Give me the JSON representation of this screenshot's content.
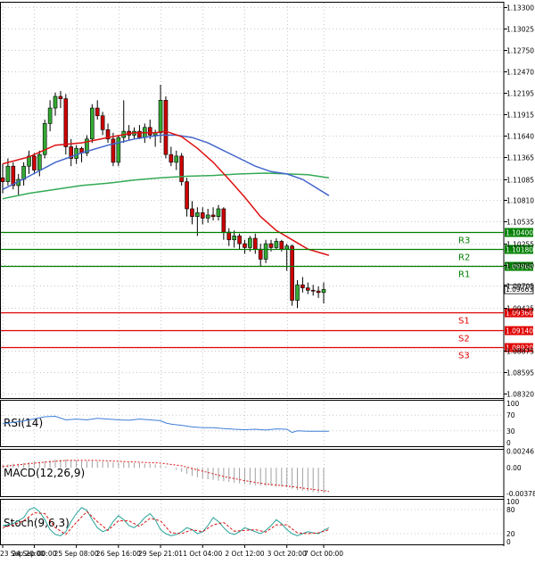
{
  "chart_data": {
    "type": "candlestick",
    "price_axis": {
      "ticks": [
        "1.13300",
        "1.13025",
        "1.12750",
        "1.12470",
        "1.12195",
        "1.11915",
        "1.11640",
        "1.11365",
        "1.11085",
        "1.10810",
        "1.10535",
        "1.10255",
        "1.09980",
        "1.09705",
        "1.09425",
        "1.08875",
        "1.08595",
        "1.08320"
      ],
      "tick_values": [
        1.133,
        1.13025,
        1.1275,
        1.1247,
        1.12195,
        1.11915,
        1.1164,
        1.11365,
        1.11085,
        1.1081,
        1.10535,
        1.10255,
        1.0998,
        1.09705,
        1.09425,
        1.08875,
        1.08595,
        1.0832
      ],
      "range": [
        1.0826,
        1.1337
      ]
    },
    "time_axis": {
      "labels": [
        "23 Sep 20:00",
        "24 Sep 00:00",
        "25 Sep 08:00",
        "26 Sep 16:00",
        "29 Sep 21:01",
        "1 Oct 04:00",
        "2 Oct 12:00",
        "3 Oct 20:00",
        "7 Oct 00:00"
      ],
      "label_bars": [
        0,
        6,
        14,
        22,
        30,
        38,
        46,
        54,
        61
      ]
    },
    "current_price": "1.09663",
    "levels": [
      {
        "name": "R3",
        "price": 1.104,
        "label": "1.10400",
        "color": "#008000"
      },
      {
        "name": "R2",
        "price": 1.1018,
        "label": "1.10180",
        "color": "#008000"
      },
      {
        "name": "R1",
        "price": 1.0996,
        "label": "1.09960",
        "color": "#008000"
      },
      {
        "name": "S1",
        "price": 1.0936,
        "label": "1.09360",
        "color": "#e00000"
      },
      {
        "name": "S2",
        "price": 1.0914,
        "label": "1.09140",
        "color": "#e00000"
      },
      {
        "name": "S3",
        "price": 1.0892,
        "label": "1.08920",
        "color": "#e00000"
      }
    ],
    "candles": [
      [
        1.111,
        1.1128,
        1.109,
        1.1105
      ],
      [
        1.1105,
        1.1135,
        1.11,
        1.1125
      ],
      [
        1.1125,
        1.113,
        1.1095,
        1.11
      ],
      [
        1.11,
        1.1115,
        1.1088,
        1.1108
      ],
      [
        1.1108,
        1.113,
        1.11,
        1.1125
      ],
      [
        1.1125,
        1.1145,
        1.1115,
        1.1138
      ],
      [
        1.1138,
        1.1142,
        1.1115,
        1.112
      ],
      [
        1.112,
        1.1145,
        1.1112,
        1.114
      ],
      [
        1.114,
        1.1185,
        1.1135,
        1.118
      ],
      [
        1.118,
        1.121,
        1.117,
        1.12
      ],
      [
        1.12,
        1.122,
        1.119,
        1.1215
      ],
      [
        1.1215,
        1.1222,
        1.12,
        1.1212
      ],
      [
        1.1212,
        1.1218,
        1.114,
        1.115
      ],
      [
        1.115,
        1.116,
        1.1125,
        1.1135
      ],
      [
        1.1135,
        1.1152,
        1.1128,
        1.1148
      ],
      [
        1.1148,
        1.115,
        1.113,
        1.1142
      ],
      [
        1.1142,
        1.1165,
        1.1138,
        1.116
      ],
      [
        1.116,
        1.1205,
        1.1155,
        1.12
      ],
      [
        1.12,
        1.121,
        1.1185,
        1.119
      ],
      [
        1.119,
        1.1195,
        1.1165,
        1.1172
      ],
      [
        1.1172,
        1.118,
        1.1155,
        1.116
      ],
      [
        1.116,
        1.1168,
        1.1125,
        1.113
      ],
      [
        1.113,
        1.1165,
        1.1125,
        1.1162
      ],
      [
        1.1162,
        1.121,
        1.1155,
        1.117
      ],
      [
        1.117,
        1.1178,
        1.1158,
        1.1165
      ],
      [
        1.1165,
        1.1175,
        1.116,
        1.117
      ],
      [
        1.117,
        1.1178,
        1.116,
        1.1162
      ],
      [
        1.1162,
        1.118,
        1.1155,
        1.1175
      ],
      [
        1.1175,
        1.1185,
        1.116,
        1.1165
      ],
      [
        1.1165,
        1.1172,
        1.115,
        1.1168
      ],
      [
        1.1168,
        1.123,
        1.1155,
        1.121
      ],
      [
        1.121,
        1.1215,
        1.1135,
        1.114
      ],
      [
        1.114,
        1.115,
        1.1125,
        1.113
      ],
      [
        1.113,
        1.1145,
        1.112,
        1.1138
      ],
      [
        1.1138,
        1.1142,
        1.11,
        1.1105
      ],
      [
        1.1105,
        1.111,
        1.106,
        1.107
      ],
      [
        1.107,
        1.108,
        1.105,
        1.106
      ],
      [
        1.106,
        1.1072,
        1.1035,
        1.1065
      ],
      [
        1.1065,
        1.1072,
        1.105,
        1.1058
      ],
      [
        1.1058,
        1.107,
        1.1052,
        1.1062
      ],
      [
        1.1062,
        1.1072,
        1.1055,
        1.106
      ],
      [
        1.106,
        1.1075,
        1.1055,
        1.107
      ],
      [
        1.107,
        1.1072,
        1.103,
        1.104
      ],
      [
        1.104,
        1.1045,
        1.1022,
        1.103
      ],
      [
        1.103,
        1.1042,
        1.102,
        1.1035
      ],
      [
        1.1035,
        1.1038,
        1.1018,
        1.1025
      ],
      [
        1.1025,
        1.103,
        1.1012,
        1.102
      ],
      [
        1.102,
        1.1035,
        1.1015,
        1.1032
      ],
      [
        1.1032,
        1.1038,
        1.1012,
        1.1018
      ],
      [
        1.1018,
        1.1025,
        1.0995,
        1.1005
      ],
      [
        1.1005,
        1.103,
        1.1,
        1.1025
      ],
      [
        1.1025,
        1.103,
        1.1015,
        1.102
      ],
      [
        1.102,
        1.1032,
        1.1018,
        1.1028
      ],
      [
        1.1028,
        1.103,
        1.1015,
        1.1018
      ],
      [
        1.1018,
        1.1025,
        1.099,
        1.1022
      ],
      [
        1.1022,
        1.1024,
        1.0945,
        1.0952
      ],
      [
        1.0952,
        1.0978,
        1.0942,
        1.0972
      ],
      [
        1.0972,
        1.0982,
        1.0962,
        1.0968
      ],
      [
        1.0968,
        1.0975,
        1.096,
        1.0965
      ],
      [
        1.0965,
        1.0972,
        1.0958,
        1.0964
      ],
      [
        1.0964,
        1.097,
        1.0955,
        1.0962
      ],
      [
        1.0962,
        1.0975,
        1.0948,
        1.0966
      ]
    ],
    "ma_fast": [
      [
        0,
        1.1128
      ],
      [
        5,
        1.1137
      ],
      [
        10,
        1.1152
      ],
      [
        15,
        1.1155
      ],
      [
        20,
        1.1162
      ],
      [
        25,
        1.1168
      ],
      [
        29,
        1.1168
      ],
      [
        31,
        1.117
      ],
      [
        34,
        1.1163
      ],
      [
        37,
        1.1148
      ],
      [
        40,
        1.113
      ],
      [
        43,
        1.1108
      ],
      [
        46,
        1.1085
      ],
      [
        49,
        1.106
      ],
      [
        52,
        1.1042
      ],
      [
        55,
        1.103
      ],
      [
        58,
        1.1018
      ],
      [
        62,
        1.101
      ]
    ],
    "ma_mid": [
      [
        0,
        1.1095
      ],
      [
        5,
        1.1112
      ],
      [
        10,
        1.113
      ],
      [
        15,
        1.1142
      ],
      [
        20,
        1.1152
      ],
      [
        25,
        1.116
      ],
      [
        30,
        1.1165
      ],
      [
        33,
        1.1165
      ],
      [
        36,
        1.1162
      ],
      [
        39,
        1.1155
      ],
      [
        42,
        1.1145
      ],
      [
        45,
        1.1135
      ],
      [
        48,
        1.1125
      ],
      [
        51,
        1.1118
      ],
      [
        54,
        1.1115
      ],
      [
        57,
        1.1108
      ],
      [
        62,
        1.1087
      ]
    ],
    "ma_slow": [
      [
        0,
        1.1083
      ],
      [
        5,
        1.109
      ],
      [
        10,
        1.1095
      ],
      [
        15,
        1.11
      ],
      [
        20,
        1.1103
      ],
      [
        25,
        1.1107
      ],
      [
        30,
        1.111
      ],
      [
        35,
        1.1112
      ],
      [
        40,
        1.1113
      ],
      [
        45,
        1.1115
      ],
      [
        50,
        1.1116
      ],
      [
        54,
        1.1115
      ],
      [
        58,
        1.1114
      ],
      [
        62,
        1.111
      ]
    ],
    "rsi": {
      "label": "RSI(14)",
      "axis_ticks": [
        "100",
        "70",
        "30",
        "0"
      ],
      "axis_values": [
        100,
        70,
        30,
        0
      ],
      "points": [
        [
          0,
          48
        ],
        [
          4,
          55
        ],
        [
          8,
          66
        ],
        [
          10,
          67
        ],
        [
          12,
          58
        ],
        [
          14,
          60
        ],
        [
          16,
          58
        ],
        [
          18,
          62
        ],
        [
          20,
          60
        ],
        [
          22,
          58
        ],
        [
          24,
          57
        ],
        [
          26,
          60
        ],
        [
          28,
          58
        ],
        [
          30,
          56
        ],
        [
          31,
          50
        ],
        [
          32,
          47
        ],
        [
          34,
          44
        ],
        [
          36,
          40
        ],
        [
          38,
          38
        ],
        [
          40,
          38
        ],
        [
          42,
          36
        ],
        [
          44,
          34
        ],
        [
          46,
          33
        ],
        [
          48,
          34
        ],
        [
          50,
          32
        ],
        [
          52,
          35
        ],
        [
          54,
          34
        ],
        [
          55,
          26
        ],
        [
          56,
          30
        ],
        [
          58,
          29
        ],
        [
          60,
          29
        ],
        [
          62,
          29
        ]
      ]
    },
    "macd": {
      "label": "MACD(12,26,9)",
      "axis_ticks": [
        "0.00246",
        "0.00",
        "-0.003788"
      ],
      "axis_values": [
        0.00246,
        0.0,
        -0.003788
      ],
      "histogram": [
        0.0004,
        0.0005,
        0.0006,
        0.0006,
        0.0007,
        0.0008,
        0.0009,
        0.0009,
        0.001,
        0.0011,
        0.0012,
        0.0012,
        0.0012,
        0.0011,
        0.0011,
        0.001,
        0.001,
        0.001,
        0.001,
        0.0009,
        0.0009,
        0.0008,
        0.0008,
        0.0008,
        0.0008,
        0.0007,
        0.0007,
        0.0006,
        0.0006,
        0.0005,
        0.0004,
        0.0002,
        0.0,
        -0.0003,
        -0.0006,
        -0.0009,
        -0.0012,
        -0.0014,
        -0.0016,
        -0.0017,
        -0.0018,
        -0.0019,
        -0.002,
        -0.0021,
        -0.0022,
        -0.0023,
        -0.0024,
        -0.0025,
        -0.0026,
        -0.0026,
        -0.0027,
        -0.0027,
        -0.0028,
        -0.0028,
        -0.0029,
        -0.0031,
        -0.0033,
        -0.0034,
        -0.0035,
        -0.0036,
        -0.0037,
        -0.0037
      ],
      "signal": [
        [
          0,
          0.0002
        ],
        [
          6,
          0.0007
        ],
        [
          12,
          0.0011
        ],
        [
          18,
          0.0011
        ],
        [
          24,
          0.0009
        ],
        [
          30,
          0.0007
        ],
        [
          34,
          0.0003
        ],
        [
          38,
          -0.0005
        ],
        [
          42,
          -0.0013
        ],
        [
          46,
          -0.0019
        ],
        [
          50,
          -0.0024
        ],
        [
          54,
          -0.0027
        ],
        [
          58,
          -0.0031
        ],
        [
          62,
          -0.0035
        ]
      ]
    },
    "stoch": {
      "label": "Stoch(9,6,3)",
      "axis_ticks": [
        "100",
        "80",
        "20",
        "0"
      ],
      "axis_values": [
        100,
        80,
        20,
        0
      ],
      "main": [
        [
          0,
          40
        ],
        [
          2,
          45
        ],
        [
          4,
          60
        ],
        [
          5,
          80
        ],
        [
          6,
          85
        ],
        [
          7,
          75
        ],
        [
          8,
          55
        ],
        [
          9,
          30
        ],
        [
          10,
          18
        ],
        [
          11,
          15
        ],
        [
          12,
          25
        ],
        [
          13,
          50
        ],
        [
          14,
          70
        ],
        [
          15,
          85
        ],
        [
          16,
          78
        ],
        [
          17,
          55
        ],
        [
          18,
          35
        ],
        [
          19,
          25
        ],
        [
          20,
          30
        ],
        [
          21,
          50
        ],
        [
          22,
          65
        ],
        [
          23,
          55
        ],
        [
          24,
          40
        ],
        [
          25,
          35
        ],
        [
          26,
          45
        ],
        [
          27,
          60
        ],
        [
          28,
          70
        ],
        [
          29,
          55
        ],
        [
          30,
          30
        ],
        [
          31,
          20
        ],
        [
          32,
          15
        ],
        [
          33,
          18
        ],
        [
          34,
          25
        ],
        [
          35,
          35
        ],
        [
          36,
          30
        ],
        [
          37,
          20
        ],
        [
          38,
          25
        ],
        [
          39,
          40
        ],
        [
          40,
          60
        ],
        [
          41,
          50
        ],
        [
          42,
          35
        ],
        [
          43,
          22
        ],
        [
          44,
          18
        ],
        [
          45,
          25
        ],
        [
          46,
          35
        ],
        [
          47,
          30
        ],
        [
          48,
          25
        ],
        [
          49,
          20
        ],
        [
          50,
          28
        ],
        [
          51,
          40
        ],
        [
          52,
          55
        ],
        [
          53,
          45
        ],
        [
          54,
          30
        ],
        [
          55,
          20
        ],
        [
          56,
          15
        ],
        [
          57,
          20
        ],
        [
          58,
          25
        ],
        [
          59,
          22
        ],
        [
          60,
          20
        ],
        [
          61,
          28
        ],
        [
          62,
          35
        ]
      ],
      "signal": [
        [
          0,
          35
        ],
        [
          2,
          42
        ],
        [
          4,
          52
        ],
        [
          6,
          72
        ],
        [
          8,
          70
        ],
        [
          10,
          35
        ],
        [
          12,
          18
        ],
        [
          14,
          48
        ],
        [
          16,
          75
        ],
        [
          18,
          50
        ],
        [
          20,
          28
        ],
        [
          22,
          52
        ],
        [
          24,
          52
        ],
        [
          26,
          38
        ],
        [
          28,
          58
        ],
        [
          30,
          52
        ],
        [
          32,
          22
        ],
        [
          34,
          20
        ],
        [
          36,
          30
        ],
        [
          38,
          25
        ],
        [
          40,
          42
        ],
        [
          42,
          48
        ],
        [
          44,
          26
        ],
        [
          46,
          28
        ],
        [
          48,
          30
        ],
        [
          50,
          24
        ],
        [
          52,
          42
        ],
        [
          54,
          42
        ],
        [
          56,
          22
        ],
        [
          58,
          20
        ],
        [
          60,
          22
        ],
        [
          62,
          30
        ]
      ]
    }
  }
}
